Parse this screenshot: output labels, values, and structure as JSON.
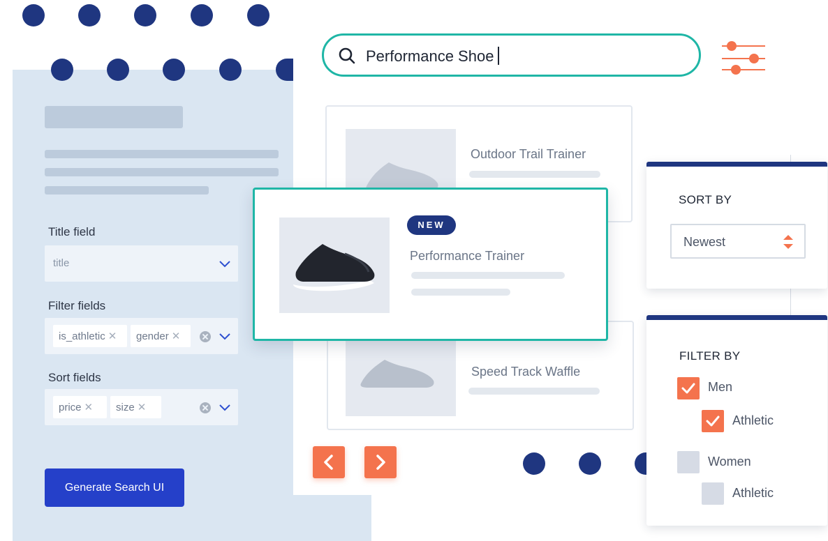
{
  "config": {
    "title_field_label": "Title field",
    "title_field_placeholder": "title",
    "filter_fields_label": "Filter fields",
    "filter_chips": [
      "is_athletic",
      "gender"
    ],
    "sort_fields_label": "Sort fields",
    "sort_chips": [
      "price",
      "size"
    ],
    "generate_label": "Generate Search UI"
  },
  "search": {
    "query": "Performance Shoe"
  },
  "products": {
    "top": {
      "title": "Outdoor Trail Trainer"
    },
    "featured": {
      "badge": "NEW",
      "title": "Performance Trainer"
    },
    "bottom": {
      "title": "Speed Track Waffle"
    }
  },
  "sort_panel": {
    "title": "SORT BY",
    "value": "Newest"
  },
  "filter_panel": {
    "title": "FILTER BY",
    "options": [
      {
        "label": "Men",
        "checked": true
      },
      {
        "label": "Athletic",
        "checked": true
      },
      {
        "label": "Women",
        "checked": false
      },
      {
        "label": "Athletic",
        "checked": false
      }
    ]
  },
  "colors": {
    "accent": "#f4734d",
    "teal": "#1fb6a6",
    "navy": "#1f3680",
    "primary": "#2540c9"
  },
  "icons": [
    "search-icon",
    "filter-sliders-icon",
    "chevron-down-icon",
    "clear-icon",
    "checkmark-icon",
    "chevron-left-icon",
    "chevron-right-icon"
  ]
}
